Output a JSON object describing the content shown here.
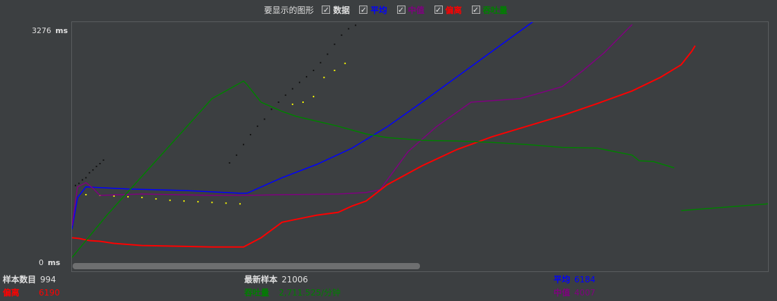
{
  "legend": {
    "title": "要显示的图形",
    "items": [
      {
        "label": "数据",
        "color": "#e0e0e0",
        "checked": true
      },
      {
        "label": "平均",
        "color": "#0000ff",
        "checked": true
      },
      {
        "label": "中值",
        "color": "#800080",
        "checked": true
      },
      {
        "label": "偏离",
        "color": "#ff0000",
        "checked": true
      },
      {
        "label": "吞吐量",
        "color": "#008000",
        "checked": true
      }
    ],
    "check_mark": "✓"
  },
  "axis": {
    "y_max": "3276",
    "y_min": "0",
    "unit": "ms"
  },
  "stats": {
    "sample_count_label": "样本数目",
    "sample_count_value": "994",
    "latest_sample_label": "最新样本",
    "latest_sample_value": "21006",
    "average_label": "平均",
    "average_value": "6184",
    "deviation_label": "偏离",
    "deviation_value": "6190",
    "throughput_label": "吞吐量",
    "throughput_value": "2,711.525/分钟",
    "median_label": "中值",
    "median_value": "4007"
  },
  "colors": {
    "data": "#111111",
    "data_yellow": "#ffff00",
    "average": "#0000ff",
    "median": "#800080",
    "deviation": "#ff0000",
    "throughput": "#008000",
    "label_default": "#e0e0e0"
  },
  "chart_data": {
    "type": "line",
    "ylim": [
      0,
      3276
    ],
    "xlim": [
      0,
      994
    ],
    "series": [
      {
        "name": "平均",
        "color": "#0000ff",
        "x": [
          0,
          8,
          20,
          40,
          80,
          160,
          240,
          250,
          300,
          350,
          400,
          450,
          500,
          550,
          600,
          650,
          700,
          750
        ],
        "y": [
          400,
          850,
          1000,
          990,
          970,
          950,
          910,
          910,
          1130,
          1320,
          1550,
          1850,
          2200,
          2560,
          2920,
          3280,
          3640,
          3990
        ]
      },
      {
        "name": "中值",
        "color": "#800080",
        "x": [
          0,
          8,
          20,
          30,
          40,
          100,
          200,
          250,
          300,
          380,
          420,
          440,
          480,
          520,
          570,
          640,
          700,
          730,
          760,
          800
        ],
        "y": [
          450,
          1000,
          1060,
          980,
          880,
          900,
          880,
          880,
          890,
          900,
          920,
          960,
          1500,
          1850,
          2200,
          2250,
          2420,
          2650,
          2900,
          3300
        ]
      },
      {
        "name": "偏离",
        "color": "#ff0000",
        "x": [
          0,
          10,
          25,
          40,
          60,
          100,
          150,
          200,
          245,
          270,
          300,
          330,
          350,
          380,
          400,
          420,
          450,
          500,
          550,
          600,
          650,
          700,
          750,
          800,
          840,
          870,
          885,
          890
        ],
        "y": [
          280,
          270,
          240,
          230,
          200,
          170,
          160,
          150,
          150,
          280,
          500,
          560,
          600,
          640,
          730,
          800,
          1030,
          1300,
          1530,
          1710,
          1860,
          2010,
          2180,
          2360,
          2550,
          2730,
          2920,
          3000
        ]
      },
      {
        "name": "吞吐量",
        "color": "#008000",
        "x": [
          0,
          50,
          100,
          150,
          200,
          245,
          250,
          270,
          300,
          320,
          350,
          380,
          420,
          450,
          500,
          550,
          600,
          650,
          700,
          750,
          800,
          810,
          830,
          860
        ],
        "y": [
          0,
          600,
          1150,
          1700,
          2250,
          2500,
          2450,
          2200,
          2070,
          2000,
          1930,
          1860,
          1750,
          1700,
          1660,
          1650,
          1630,
          1600,
          1560,
          1550,
          1450,
          1370,
          1360,
          1270
        ]
      },
      {
        "name": "吞吐量",
        "color": "#008000",
        "x": [
          870,
          994
        ],
        "y": [
          665,
          760
        ]
      }
    ],
    "scatter": [
      {
        "color": "#111111",
        "x": [
          5,
          10,
          15,
          20,
          25,
          30,
          35,
          40,
          45,
          225,
          235,
          245,
          255,
          265,
          275,
          285,
          295,
          305,
          315,
          325,
          335,
          345,
          355,
          365,
          375,
          385,
          395,
          405
        ],
        "y": [
          1020,
          1050,
          1100,
          1130,
          1200,
          1240,
          1290,
          1330,
          1380,
          1340,
          1450,
          1600,
          1740,
          1860,
          1960,
          2100,
          2200,
          2300,
          2390,
          2480,
          2560,
          2650,
          2760,
          2880,
          3020,
          3150,
          3240,
          3290
        ]
      },
      {
        "color": "#ffff00",
        "x": [
          20,
          40,
          60,
          80,
          100,
          120,
          140,
          160,
          180,
          200,
          220,
          240,
          315,
          330,
          345,
          360,
          375,
          390
        ],
        "y": [
          890,
          880,
          870,
          860,
          850,
          830,
          810,
          800,
          790,
          780,
          770,
          760,
          2170,
          2200,
          2280,
          2550,
          2650,
          2750
        ]
      }
    ]
  }
}
